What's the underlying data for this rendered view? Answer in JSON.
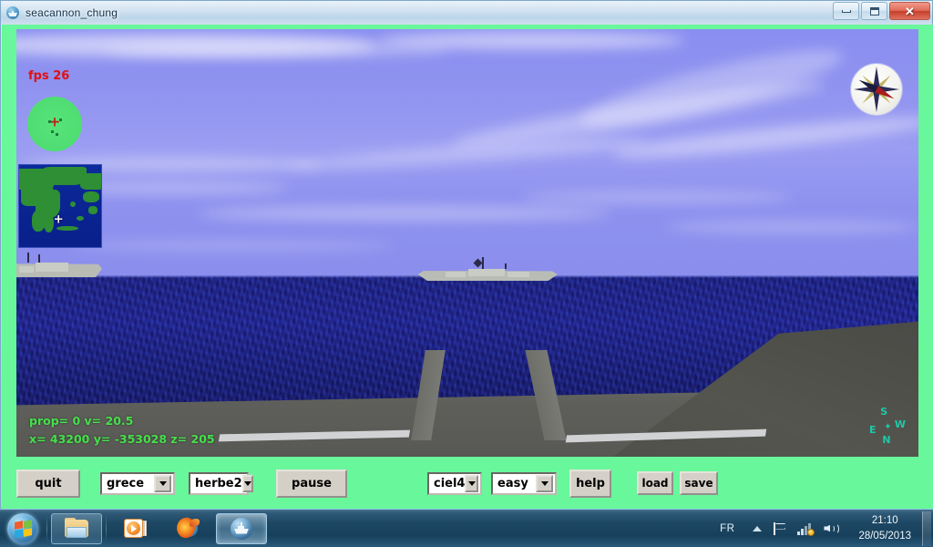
{
  "window": {
    "title": "seacannon_chung",
    "icon": "ship-globe-icon",
    "minimize_label": "Minimize",
    "maximize_label": "Maximize",
    "close_label": "✕"
  },
  "hud": {
    "fps_label": "fps 26",
    "fps_color": "#e01010",
    "telemetry_line1": "prop= 0  v= 20.5",
    "telemetry_line2": "x= 43200  y= -353028  z= 205",
    "telemetry_color": "#45e04a",
    "radar_marker": "+",
    "minimap_marker": "+",
    "minicompass": {
      "north": "N",
      "south": "S",
      "east": "E",
      "west": "W",
      "pointer": "✦"
    }
  },
  "scene": {
    "sky_color": "#8f92ef",
    "sea_color": "#1b1f86",
    "deck_color": "#5e5e5a",
    "ships": [
      {
        "name": "near-warship-left"
      },
      {
        "name": "distant-warship-center"
      }
    ]
  },
  "controls": {
    "quit_label": "quit",
    "map_select": "grece",
    "terrain_select": "herbe2",
    "pause_label": "pause",
    "sky_select": "ciel4",
    "difficulty_select": "easy",
    "help_label": "help",
    "load_label": "load",
    "save_label": "save"
  },
  "taskbar": {
    "start_label": "Start",
    "items": [
      {
        "name": "windows-explorer",
        "icon": "folder-icon"
      },
      {
        "name": "windows-media-player",
        "icon": "media-player-icon"
      },
      {
        "name": "mozilla-firefox",
        "icon": "firefox-icon"
      },
      {
        "name": "seacannon-chung",
        "icon": "ship-globe-icon"
      }
    ],
    "tray": {
      "language": "FR",
      "show_hidden": "show-hidden-icons",
      "flag": "action-center-flag-icon",
      "network": "network-icon",
      "volume": "volume-icon",
      "time": "21:10",
      "date": "28/05/2013"
    }
  },
  "colors": {
    "app_background": "#68f79a",
    "button_face": "#d4d0c8",
    "taskbar": "#1d4763"
  }
}
